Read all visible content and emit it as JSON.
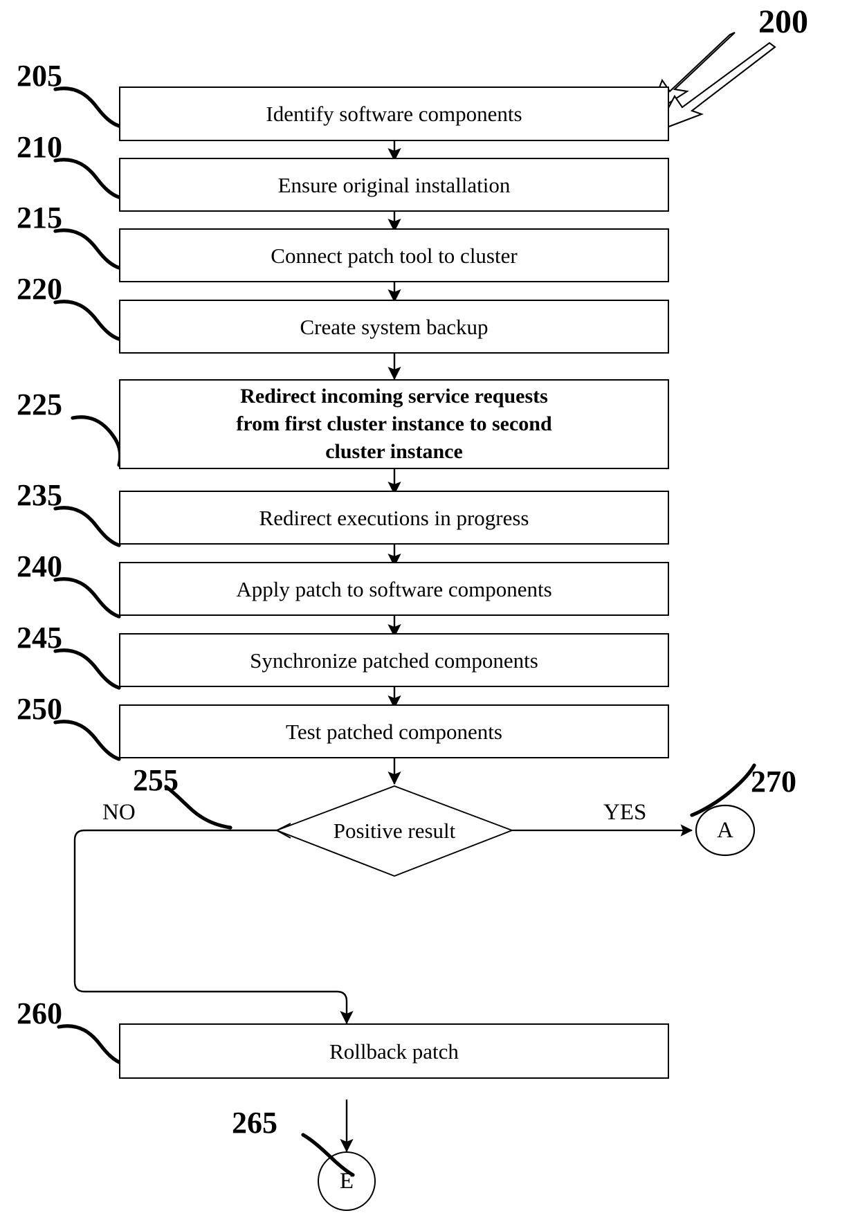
{
  "figure": {
    "number": "200",
    "type": "patent-flowchart"
  },
  "steps": [
    {
      "ref": "205",
      "label": "Identify software components"
    },
    {
      "ref": "210",
      "label": "Ensure original installation"
    },
    {
      "ref": "215",
      "label": "Connect patch tool to cluster"
    },
    {
      "ref": "220",
      "label": "Create system backup"
    },
    {
      "ref": "225",
      "label": "Redirect incoming service requests\nfrom first cluster instance to second\ncluster instance"
    },
    {
      "ref": "235",
      "label": "Redirect executions in progress"
    },
    {
      "ref": "240",
      "label": "Apply patch to software components"
    },
    {
      "ref": "245",
      "label": "Synchronize patched components"
    },
    {
      "ref": "250",
      "label": "Test patched components"
    }
  ],
  "decision": {
    "ref": "255",
    "label": "Positive result",
    "yes_label": "YES",
    "no_label": "NO"
  },
  "rollback": {
    "ref": "260",
    "label": "Rollback patch"
  },
  "connectors": [
    {
      "ref": "270",
      "label": "A"
    },
    {
      "ref": "265",
      "label": "E"
    }
  ],
  "colors": {
    "stroke": "#000000",
    "fill": "#ffffff",
    "text": "#000000"
  }
}
